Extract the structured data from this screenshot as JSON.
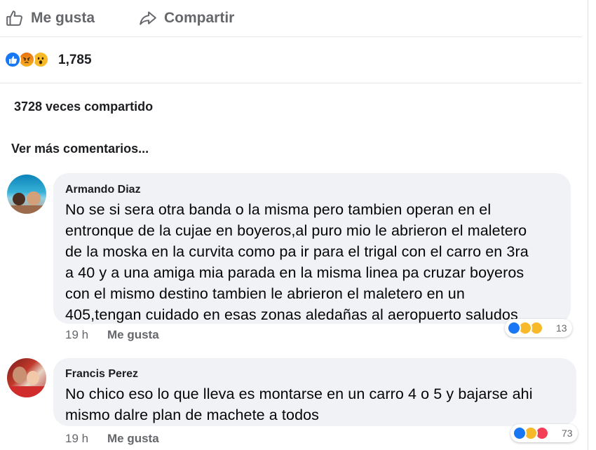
{
  "actions": {
    "like_label": "Me gusta",
    "share_label": "Compartir"
  },
  "post": {
    "reaction_count": "1,785",
    "shares_text": "3728 veces compartido",
    "more_comments": "Ver más comentarios..."
  },
  "comments": [
    {
      "author": "Armando Diaz",
      "lines": [
        "No se si sera otra banda o la misma pero tambien operan en el",
        "entronque de la cujae en boyeros,al puro mio le abrieron el maletero",
        "de la moska en la curvita como pa ir para el trigal con el carro en 3ra",
        "a 40 y a una amiga mia parada en la misma linea pa cruzar boyeros",
        "con el mismo destino tambien le abrieron el maletero en un",
        "405,tengan cuidado en esas zonas aledañas al aeropuerto saludos"
      ],
      "time": "19 h",
      "like_label": "Me gusta",
      "reaction_count": "13"
    },
    {
      "author": "Francis Perez",
      "lines": [
        "No chico eso lo que lleva es montarse en un carro 4 o 5  y bajarse ahi",
        "mismo dalre plan de machete a todos"
      ],
      "time": "19 h",
      "like_label": "Me gusta",
      "reaction_count": "73"
    }
  ],
  "colors": {
    "like_blue": "#1877f2",
    "bubble_bg": "#f0f2f5",
    "meta_gray": "#65676b"
  }
}
